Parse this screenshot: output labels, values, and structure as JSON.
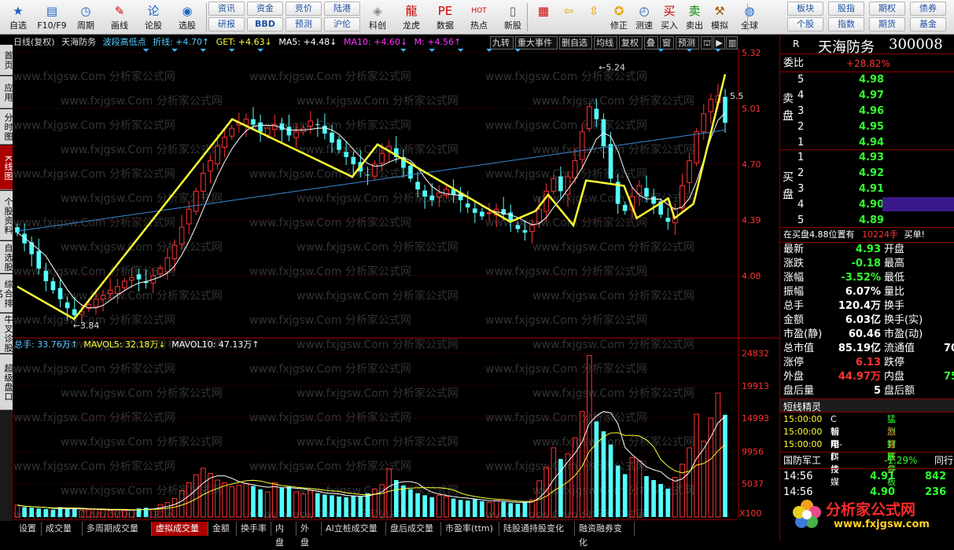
{
  "toolbar": {
    "items": [
      {
        "label": "自选",
        "icon": "star-icon",
        "glyph": "★",
        "fg": "#1c62c4"
      },
      {
        "label": "F10/F9",
        "icon": "f10-icon",
        "glyph": "▤",
        "fg": "#1c62c4"
      },
      {
        "label": "周期",
        "icon": "clock-icon",
        "glyph": "◷",
        "fg": "#1c62c4"
      },
      {
        "label": "画线",
        "icon": "pencil-icon",
        "glyph": "✎",
        "fg": "#c00"
      },
      {
        "label": "论股",
        "icon": "discuss-icon",
        "glyph": "论",
        "fg": "#1c62c4"
      },
      {
        "label": "选股",
        "icon": "select-stock-icon",
        "glyph": "◉",
        "fg": "#1c62c4"
      }
    ],
    "small_buttons": [
      [
        "资讯",
        "资金",
        "竞价",
        "陆港"
      ],
      [
        "研报",
        "BBD",
        "预测",
        "沪伦"
      ]
    ],
    "items2": [
      {
        "label": "科创",
        "icon": "sci-icon",
        "glyph": "◈",
        "fg": "#888"
      },
      {
        "label": "龙虎",
        "icon": "dragon-icon",
        "glyph": "龍",
        "fg": "#c00"
      },
      {
        "label": "数据",
        "icon": "pe-icon",
        "glyph": "PE",
        "fg": "#c00"
      },
      {
        "label": "热点",
        "icon": "hot-icon",
        "glyph": "HOT",
        "fg": "#c00"
      },
      {
        "label": "新股",
        "icon": "new-stock-icon",
        "glyph": "▯",
        "fg": "#555"
      }
    ],
    "items3": [
      {
        "label": "",
        "icon": "grid-icon",
        "glyph": "▦",
        "fg": "#c00"
      },
      {
        "label": "",
        "icon": "back-arrow-icon",
        "glyph": "⇦",
        "fg": "#e8a000"
      },
      {
        "label": "",
        "icon": "up-down-icon",
        "glyph": "⇳",
        "fg": "#e8a000"
      },
      {
        "label": "修正",
        "icon": "fix-icon",
        "glyph": "✪",
        "fg": "#e8a000"
      },
      {
        "label": "测速",
        "icon": "speed-icon",
        "glyph": "◴",
        "fg": "#1c62c4"
      },
      {
        "label": "买入",
        "icon": "buy-icon",
        "glyph": "买",
        "fg": "#c00"
      },
      {
        "label": "卖出",
        "icon": "sell-icon",
        "glyph": "卖",
        "fg": "#080"
      },
      {
        "label": "模拟",
        "icon": "hammer-icon",
        "glyph": "⚒",
        "fg": "#a50"
      },
      {
        "label": "全球",
        "icon": "globe-icon",
        "glyph": "◍",
        "fg": "#1c62c4"
      }
    ],
    "right_buttons": [
      [
        "板块",
        "股指",
        "期权",
        "债券"
      ],
      [
        "个股",
        "指数",
        "期货",
        "基金"
      ]
    ]
  },
  "left_tabs": [
    "首页",
    "应用",
    "分时图",
    "K线图",
    "个股资料",
    "自选股",
    "综合排名",
    "牛叉诊股",
    "超级盘口"
  ],
  "chart_header": {
    "period": "日线(复权)",
    "name": "天海防务",
    "indicator": "波段高低点",
    "zhexian": "折线: +4.70↑",
    "get": "GET: +4.63↓",
    "ma5": "MA5: +4.48↓",
    "ma10": "MA10: +4.60↓",
    "m": "M: +4.56↑"
  },
  "chart_buttons": [
    "九转",
    "重大事件",
    "删自选",
    "均线",
    "复权",
    "叠",
    "窗",
    "预测"
  ],
  "watermark": "www.fxjgsw.Com 分析家公式网",
  "price_labels": [
    "5.32",
    "5.01",
    "4.70",
    "4.39",
    "4.08"
  ],
  "peak_labels": {
    "high": "5.24",
    "low": "3.84",
    "right": "5.5"
  },
  "volume_header": {
    "total": "总手: 33.76万↑",
    "mavol5": "MAVOL5: 32.18万↓",
    "mavol10": "MAVOL10: 47.13万↑"
  },
  "volume_labels": [
    "24832",
    "19913",
    "14993",
    "9956",
    "5037"
  ],
  "x100": "X100",
  "bottom_tabs": [
    "设置",
    "成交量",
    "多周期成交量",
    "虚拟成交量",
    "金额",
    "换手率",
    "内盘",
    "外盘",
    "AI立桩成交量",
    "盘后成交量",
    "市盈率(ttm)",
    "陆股通持股变化",
    "融资融券变化"
  ],
  "active_bottom_tab": 3,
  "right_panel": {
    "tag": "R",
    "stock_name": "天海防务",
    "stock_code": "300008",
    "weibi_label": "委比",
    "weibi_value": "+28.82%",
    "sell_label": "卖盘",
    "buy_label": "买盘",
    "sells": [
      {
        "n": "5",
        "p": "4.98"
      },
      {
        "n": "4",
        "p": "4.97"
      },
      {
        "n": "3",
        "p": "4.96"
      },
      {
        "n": "2",
        "p": "4.95"
      },
      {
        "n": "1",
        "p": "4.94"
      }
    ],
    "buys": [
      {
        "n": "1",
        "p": "4.93"
      },
      {
        "n": "2",
        "p": "4.92"
      },
      {
        "n": "3",
        "p": "4.91"
      },
      {
        "n": "4",
        "p": "4.90"
      },
      {
        "n": "5",
        "p": "4.89"
      }
    ],
    "notice_pre": "在买盘4.88位置有",
    "notice_vol": "10224手",
    "notice_post": "买单!",
    "stats": [
      {
        "l": "最新",
        "v": "4.93",
        "c": "green",
        "l2": "开盘",
        "v2": ""
      },
      {
        "l": "涨跌",
        "v": "-0.18",
        "c": "green",
        "l2": "最高",
        "v2": ""
      },
      {
        "l": "涨幅",
        "v": "-3.52%",
        "c": "green",
        "l2": "最低",
        "v2": ""
      },
      {
        "l": "振幅",
        "v": "6.07%",
        "c": "white",
        "l2": "量比",
        "v2": ""
      },
      {
        "l": "总手",
        "v": "120.4万",
        "c": "white",
        "l2": "换手",
        "v2": ""
      },
      {
        "l": "金额",
        "v": "6.03亿",
        "c": "white",
        "l2": "换手(实)",
        "v2": ""
      },
      {
        "l": "市盈(静)",
        "v": "60.46",
        "c": "white",
        "l2": "市盈(动)",
        "v2": ""
      },
      {
        "l": "总市值",
        "v": "85.19亿",
        "c": "white",
        "l2": "流通值",
        "v2": "70"
      },
      {
        "l": "涨停",
        "v": "6.13",
        "c": "red",
        "l2": "跌停",
        "v2": ""
      },
      {
        "l": "外盘",
        "v": "44.97万",
        "c": "red",
        "l2": "内盘",
        "v2": "75"
      },
      {
        "l": "盘后量",
        "v": "5",
        "c": "white",
        "l2": "盘后额",
        "v2": ""
      }
    ],
    "short_title": "短线精灵",
    "short_items": [
      {
        "t": "15:00:00",
        "n": "C智翔-U",
        "e": "猛烈打压",
        "ec": "green"
      },
      {
        "t": "15:00:00",
        "n": "朝阳科技",
        "e": "急速拉升",
        "ec": "red"
      },
      {
        "t": "15:00:00",
        "n": "电广传媒",
        "e": "封跌停板",
        "ec": "green"
      }
    ],
    "sector_name": "国防军工",
    "sector_change": "-1.29%",
    "sector_tail": "同行",
    "ticks": [
      {
        "t": "14:56",
        "p": "4.91",
        "v": "842"
      },
      {
        "t": "14:56",
        "p": "4.90",
        "v": "236"
      }
    ],
    "logo_text": "分析家公式网",
    "logo_url": "www.fxjgsw.com"
  },
  "chart_data": {
    "type": "candlestick",
    "price_axis": [
      3.77,
      5.32
    ],
    "volume_axis": [
      0,
      25500
    ],
    "zigzag_points": [
      [
        0,
        4.02
      ],
      [
        9,
        3.84
      ],
      [
        34,
        4.95
      ],
      [
        53,
        4.63
      ],
      [
        57,
        4.81
      ],
      [
        78,
        4.38
      ],
      [
        82,
        4.44
      ],
      [
        84,
        4.53
      ],
      [
        88,
        4.36
      ],
      [
        90,
        4.61
      ],
      [
        96,
        4.58
      ],
      [
        98,
        4.4
      ],
      [
        103,
        4.51
      ],
      [
        104,
        4.4
      ],
      [
        107,
        4.48
      ],
      [
        112,
        5.2
      ]
    ],
    "closes": [
      4.32,
      4.26,
      4.2,
      4.12,
      4.05,
      4.0,
      3.95,
      3.9,
      3.86,
      3.88,
      3.92,
      3.95,
      3.97,
      4.0,
      4.02,
      4.05,
      4.07,
      4.06,
      4.04,
      4.08,
      4.12,
      4.18,
      4.25,
      4.35,
      4.45,
      4.55,
      4.65,
      4.72,
      4.8,
      4.85,
      4.9,
      4.93,
      4.95,
      4.92,
      4.88,
      4.9,
      4.92,
      4.89,
      4.86,
      4.88,
      4.9,
      4.94,
      4.92,
      4.87,
      4.82,
      4.78,
      4.74,
      4.7,
      4.66,
      4.64,
      4.7,
      4.76,
      4.8,
      4.74,
      4.68,
      4.62,
      4.56,
      4.52,
      4.5,
      4.54,
      4.56,
      4.53,
      4.5,
      4.46,
      4.43,
      4.41,
      4.43,
      4.45,
      4.42,
      4.38,
      4.34,
      4.32,
      4.36,
      4.45,
      4.55,
      4.62,
      4.55,
      4.63,
      4.72,
      4.88,
      5.02,
      4.95,
      4.8,
      4.62,
      4.48,
      4.44,
      4.52,
      4.58,
      4.52,
      4.48,
      4.42,
      4.38,
      4.45,
      4.58,
      4.72,
      4.88,
      4.98,
      5.06,
      5.08,
      4.93
    ],
    "volumes": [
      1800,
      1500,
      1400,
      1300,
      1200,
      1100,
      1500,
      1300,
      1200,
      1000,
      1100,
      1200,
      1100,
      1000,
      1050,
      1000,
      1100,
      1300,
      1400,
      1200,
      1900,
      2200,
      2800,
      4000,
      5200,
      6400,
      7400,
      6600,
      5600,
      5200,
      4600,
      4800,
      5100,
      4700,
      4200,
      3800,
      5200,
      4400,
      4600,
      3800,
      3500,
      4100,
      3600,
      3400,
      3300,
      3100,
      3000,
      3200,
      3100,
      3600,
      4200,
      4900,
      7300,
      5600,
      4800,
      4200,
      3600,
      3300,
      3000,
      3300,
      3100,
      2800,
      2600,
      2500,
      2700,
      2400,
      2200,
      2500,
      2300,
      2100,
      2000,
      2300,
      2600,
      5500,
      7500,
      10500,
      8800,
      9600,
      12000,
      16000,
      24500,
      14500,
      13000,
      11000,
      7800,
      6500,
      9000,
      8500,
      6200,
      5600,
      5000,
      4300,
      6000,
      8000,
      10500,
      15600,
      11500,
      15000,
      18800,
      15500
    ]
  }
}
